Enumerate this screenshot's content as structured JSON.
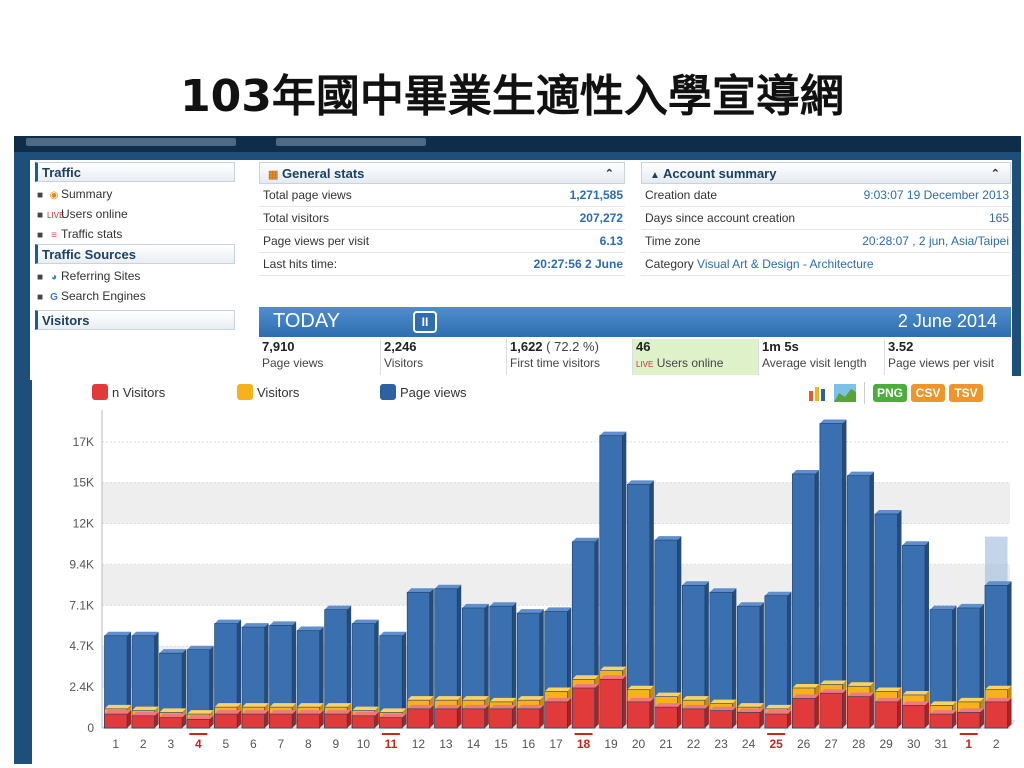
{
  "page": {
    "title": "103年國中畢業生適性入學宣導網"
  },
  "sidebar": {
    "sections": [
      {
        "title": "Traffic",
        "items": [
          {
            "label": "Summary",
            "icon": "summary-icon"
          },
          {
            "label": "Users online",
            "icon": "live-icon"
          },
          {
            "label": "Traffic stats",
            "icon": "stats-icon"
          }
        ]
      },
      {
        "title": "Traffic Sources",
        "items": [
          {
            "label": "Referring Sites",
            "icon": "referring-icon"
          },
          {
            "label": "Search Engines",
            "icon": "google-icon"
          }
        ]
      },
      {
        "title": "Visitors",
        "items": []
      }
    ]
  },
  "general_stats": {
    "title": "General stats",
    "rows": [
      {
        "label": "Total page views",
        "value": "1,271,585"
      },
      {
        "label": "Total visitors",
        "value": "207,272"
      },
      {
        "label": "Page views per visit",
        "value": "6.13"
      },
      {
        "label": "Last hits time:",
        "value": "20:27:56 2 June"
      }
    ]
  },
  "account_summary": {
    "title": "Account summary",
    "rows": [
      {
        "label": "Creation date",
        "value": "9:03:07 19 December 2013"
      },
      {
        "label": "Days since account creation",
        "value": "165"
      },
      {
        "label": "Time zone",
        "value": "20:28:07 , 2 jun, Asia/Taipei"
      },
      {
        "label": "Category",
        "value": "Visual Art & Design - Architecture"
      }
    ]
  },
  "today": {
    "label": "TODAY",
    "pause": "II",
    "date": "2 June 2014",
    "stats": [
      {
        "value": "7,910",
        "pct": "",
        "caption": "Page views"
      },
      {
        "value": "2,246",
        "pct": "",
        "caption": "Visitors"
      },
      {
        "value": "1,622",
        "pct": " ( 72.2 %)",
        "caption": "First time visitors"
      },
      {
        "value": "46",
        "pct": "",
        "caption": "Users online"
      },
      {
        "value": "1m 5s",
        "pct": "",
        "caption": "Average visit length"
      },
      {
        "value": "3.52",
        "pct": "",
        "caption": "Page views per visit"
      }
    ]
  },
  "export": {
    "png": "PNG",
    "csv": "CSV",
    "tsv": "TSV"
  },
  "chart_data": {
    "type": "bar",
    "categories": [
      "1",
      "2",
      "3",
      "4",
      "5",
      "6",
      "7",
      "8",
      "9",
      "10",
      "11",
      "12",
      "13",
      "14",
      "15",
      "16",
      "17",
      "18",
      "19",
      "20",
      "21",
      "22",
      "23",
      "24",
      "25",
      "26",
      "27",
      "28",
      "29",
      "30",
      "31",
      "1",
      "2"
    ],
    "highlighted_categories": [
      "4",
      "11",
      "18",
      "25",
      "1"
    ],
    "yticks": [
      "0",
      "2.4K",
      "4.7K",
      "7.1K",
      "9.4K",
      "12K",
      "15K",
      "17K"
    ],
    "ylim": [
      0,
      17700
    ],
    "series": [
      {
        "name": "n Visitors",
        "color": "#e03a3a",
        "values": [
          800,
          700,
          600,
          500,
          800,
          800,
          800,
          800,
          800,
          700,
          600,
          1100,
          1100,
          1100,
          1100,
          1100,
          1500,
          2300,
          2800,
          1500,
          1200,
          1100,
          1000,
          900,
          800,
          1700,
          2000,
          1800,
          1500,
          1300,
          800,
          900,
          1500
        ]
      },
      {
        "name": "Visitors",
        "color": "#f5b21b",
        "values": [
          1100,
          1000,
          900,
          800,
          1200,
          1200,
          1200,
          1200,
          1200,
          1000,
          900,
          1600,
          1600,
          1600,
          1500,
          1600,
          2100,
          2800,
          3300,
          2200,
          1800,
          1600,
          1400,
          1200,
          1100,
          2300,
          2500,
          2400,
          2100,
          1900,
          1300,
          1500,
          2200
        ]
      },
      {
        "name": "Page views",
        "color": "#2e61a0",
        "values": [
          5300,
          5300,
          4300,
          4500,
          6000,
          5800,
          5900,
          5600,
          6800,
          6000,
          5300,
          7800,
          8000,
          6900,
          7000,
          6600,
          6700,
          10700,
          16800,
          14000,
          10800,
          8200,
          7800,
          7000,
          7600,
          14600,
          17500,
          14500,
          12300,
          10500,
          6800,
          6900,
          8200
        ]
      }
    ],
    "projected": {
      "category": "2",
      "value": 11000
    }
  }
}
